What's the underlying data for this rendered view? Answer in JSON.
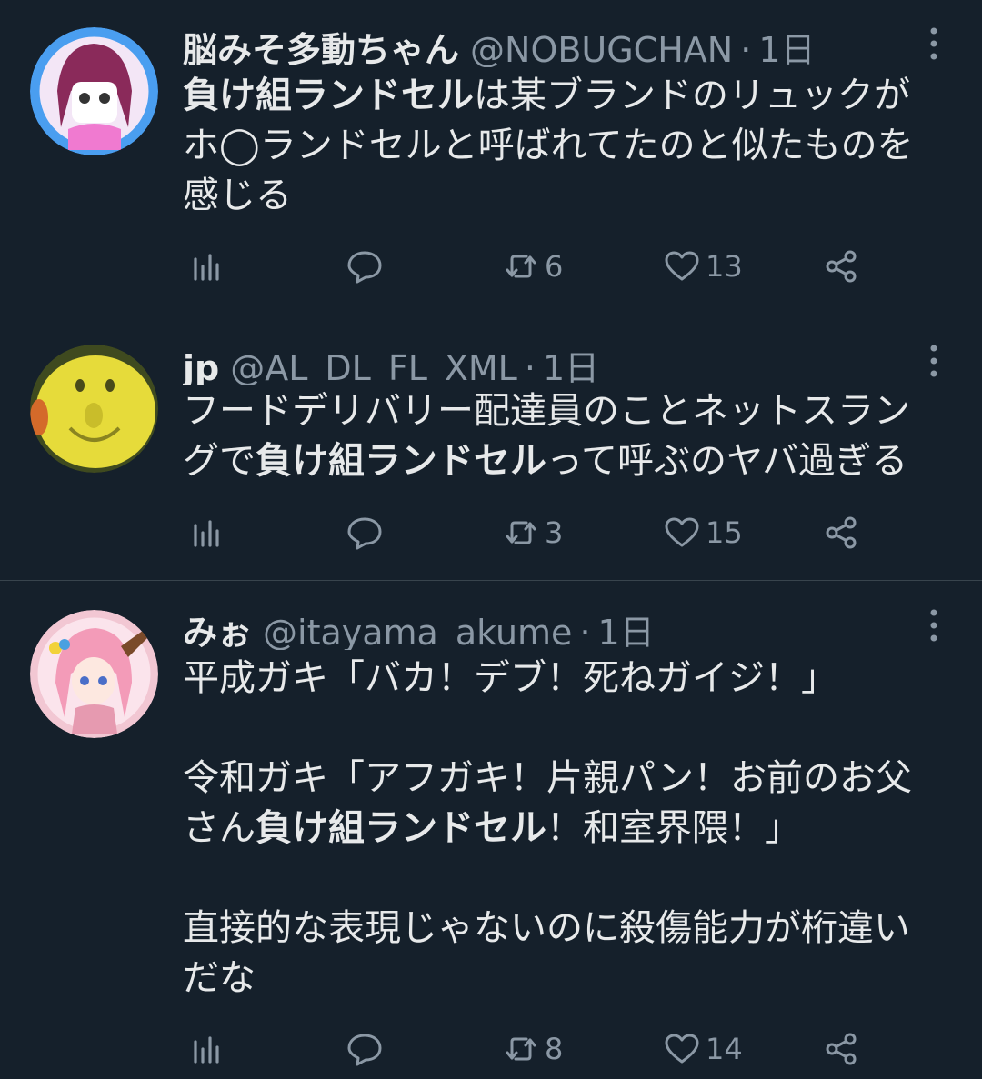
{
  "tweets": [
    {
      "name": "脳みそ多動ちゃん",
      "handle": "@NOBUGCHAN",
      "dot": "·",
      "time": "1日",
      "lines": [
        [
          {
            "t": "負け組ランドセル",
            "b": true
          },
          {
            "t": "は某ブランドのリュックが",
            "b": false
          }
        ],
        [
          {
            "t": "ホ◯ランドセルと呼ばれてたのと似たものを",
            "b": false
          }
        ],
        [
          {
            "t": "感じる",
            "b": false
          }
        ]
      ],
      "retweets": "6",
      "likes": "13",
      "avatar_colors": {
        "bg": "#4a9ef0",
        "inner": "#f3e6f6",
        "hair": "#8a2a5a"
      }
    },
    {
      "name": "jp",
      "handle": "@AL_DL_FL_XML",
      "dot": "·",
      "time": "1日",
      "lines": [
        [
          {
            "t": "フードデリバリー配達員のことネットスラン",
            "b": false
          }
        ],
        [
          {
            "t": "グで",
            "b": false
          },
          {
            "t": "負け組ランドセル",
            "b": true
          },
          {
            "t": "って呼ぶのヤバ過ぎる",
            "b": false
          }
        ]
      ],
      "retweets": "3",
      "likes": "15",
      "avatar_colors": {
        "bg": "#3f4a1f",
        "face": "#e6db3a"
      }
    },
    {
      "name": "みぉ",
      "handle": "@itayama_akume",
      "dot": "·",
      "time": "1日",
      "lines": [
        [
          {
            "t": "平成ガキ「バカ！デブ！死ねガイジ！」",
            "b": false
          }
        ],
        [],
        [
          {
            "t": "令和ガキ「アフガキ！片親パン！お前のお父",
            "b": false
          }
        ],
        [
          {
            "t": "さん",
            "b": false
          },
          {
            "t": "負け組ランドセル",
            "b": true
          },
          {
            "t": "！和室界隈！」",
            "b": false
          }
        ],
        [],
        [
          {
            "t": "直接的な表現じゃないのに殺傷能力が桁違い",
            "b": false
          }
        ],
        [
          {
            "t": "だな",
            "b": false
          }
        ]
      ],
      "retweets": "8",
      "likes": "14",
      "avatar_colors": {
        "bg": "#f2c7d3",
        "hair": "#f39bb8"
      }
    }
  ],
  "icons": {
    "views": "bar-chart-icon",
    "reply": "speech-bubble-icon",
    "retweet": "retweet-arrows-icon",
    "like": "heart-icon",
    "share": "share-nodes-icon",
    "more": "vertical-dots-icon"
  },
  "colors": {
    "background": "#15202b",
    "text": "#e7e9ea",
    "secondary": "#8b98a5",
    "divider": "#38444d"
  }
}
